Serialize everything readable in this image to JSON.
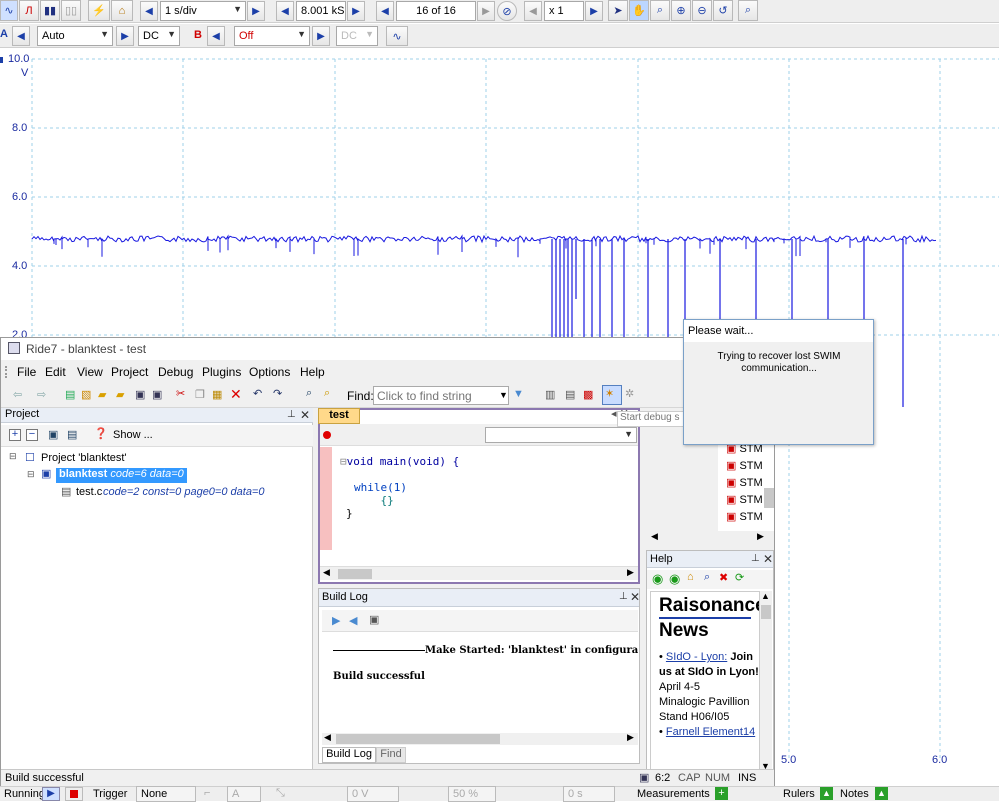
{
  "scope": {
    "timebase": "1 s/div",
    "samples": "8.001 kS",
    "capture": "16 of 16",
    "zoom": "x 1",
    "channel_a": {
      "label": "A",
      "range": "Auto",
      "coupling": "DC"
    },
    "channel_b": {
      "label": "B",
      "range": "Off",
      "coupling": "DC"
    },
    "y_ticks": [
      "10.0",
      "V",
      "8.0",
      "6.0",
      "4.0",
      "2.0"
    ],
    "x_ticks": [
      "5.0",
      "6.0"
    ],
    "trace_color": "#1818e0",
    "status": {
      "running": "Running",
      "trigger_label": "Trigger",
      "trigger_mode": "None",
      "trigger_channel": "A",
      "level": "0 V",
      "percent": "50 %",
      "delay": "0 s",
      "measurements": "Measurements",
      "rulers": "Rulers",
      "notes": "Notes"
    }
  },
  "ride": {
    "title": "Ride7 - blanktest - test",
    "menu": [
      "File",
      "Edit",
      "View",
      "Project",
      "Debug",
      "Plugins",
      "Options",
      "Help"
    ],
    "find_label": "Find:",
    "find_placeholder": "Click to find string",
    "debug_tooltip": "Start debug s",
    "project_panel": {
      "title": "Project",
      "show_label": "Show ...",
      "root": "Project 'blanktest'",
      "app_name": "blanktest",
      "app_info": "code=6 data=0",
      "file_name": "test.c",
      "file_info": "code=2 const=0 page0=0 data=0"
    },
    "editor": {
      "tab": "test",
      "code_lines": [
        "void main(void) {",
        "",
        "while(1)",
        "    {}",
        "}"
      ]
    },
    "build_log": {
      "title": "Build Log",
      "line1": "Make Started: 'blanktest' in configura",
      "line2": "Build successful",
      "tabs": [
        "Build Log",
        "Find"
      ]
    },
    "help": {
      "title": "Help",
      "heading1": "Raisonance",
      "heading2": "News",
      "news_link": "SIdO - Lyon:",
      "news_bold": "Join us at SIdO in Lyon!",
      "news_date": "April 4-5",
      "news_venue": "Minalogic Pavillion",
      "news_stand": "Stand H06/I05",
      "news_link2": "Farnell Element14"
    },
    "items_list": [
      "STM",
      "STM",
      "STM",
      "STM",
      "STM",
      "STM"
    ],
    "statusbar": {
      "text": "Build successful",
      "position": "6:2",
      "cap": "CAP",
      "num": "NUM",
      "ins": "INS"
    }
  },
  "dialog": {
    "title": "Please wait...",
    "message": "Trying to recover lost SWIM communication..."
  }
}
